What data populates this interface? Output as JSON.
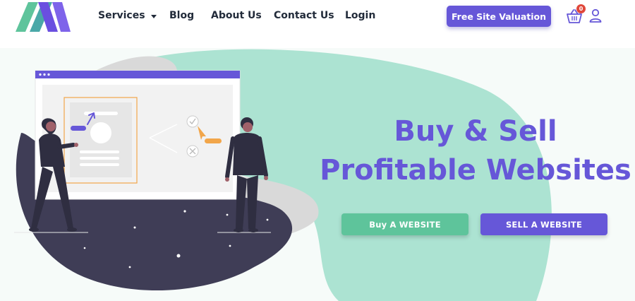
{
  "nav": {
    "services": "Services",
    "blog": "Blog",
    "about": "About Us",
    "contact": "Contact Us",
    "login": "Login"
  },
  "header": {
    "cta": "Free Site Valuation",
    "cart_count": "0",
    "logo_icon": "brand-logo",
    "cart_icon": "basket-icon",
    "user_icon": "user-icon"
  },
  "hero": {
    "headline_line1": "Buy & Sell",
    "headline_line2": "Profitable Websites",
    "buy_button": "Buy A WEBSITE",
    "sell_button": "SELL A WEBSITE"
  },
  "colors": {
    "brand_purple": "#6657d8",
    "brand_green": "#5ec49b",
    "mint_blob": "#ace3d2",
    "dark_blob": "#3f3d56",
    "badge_red": "#e0473a"
  }
}
